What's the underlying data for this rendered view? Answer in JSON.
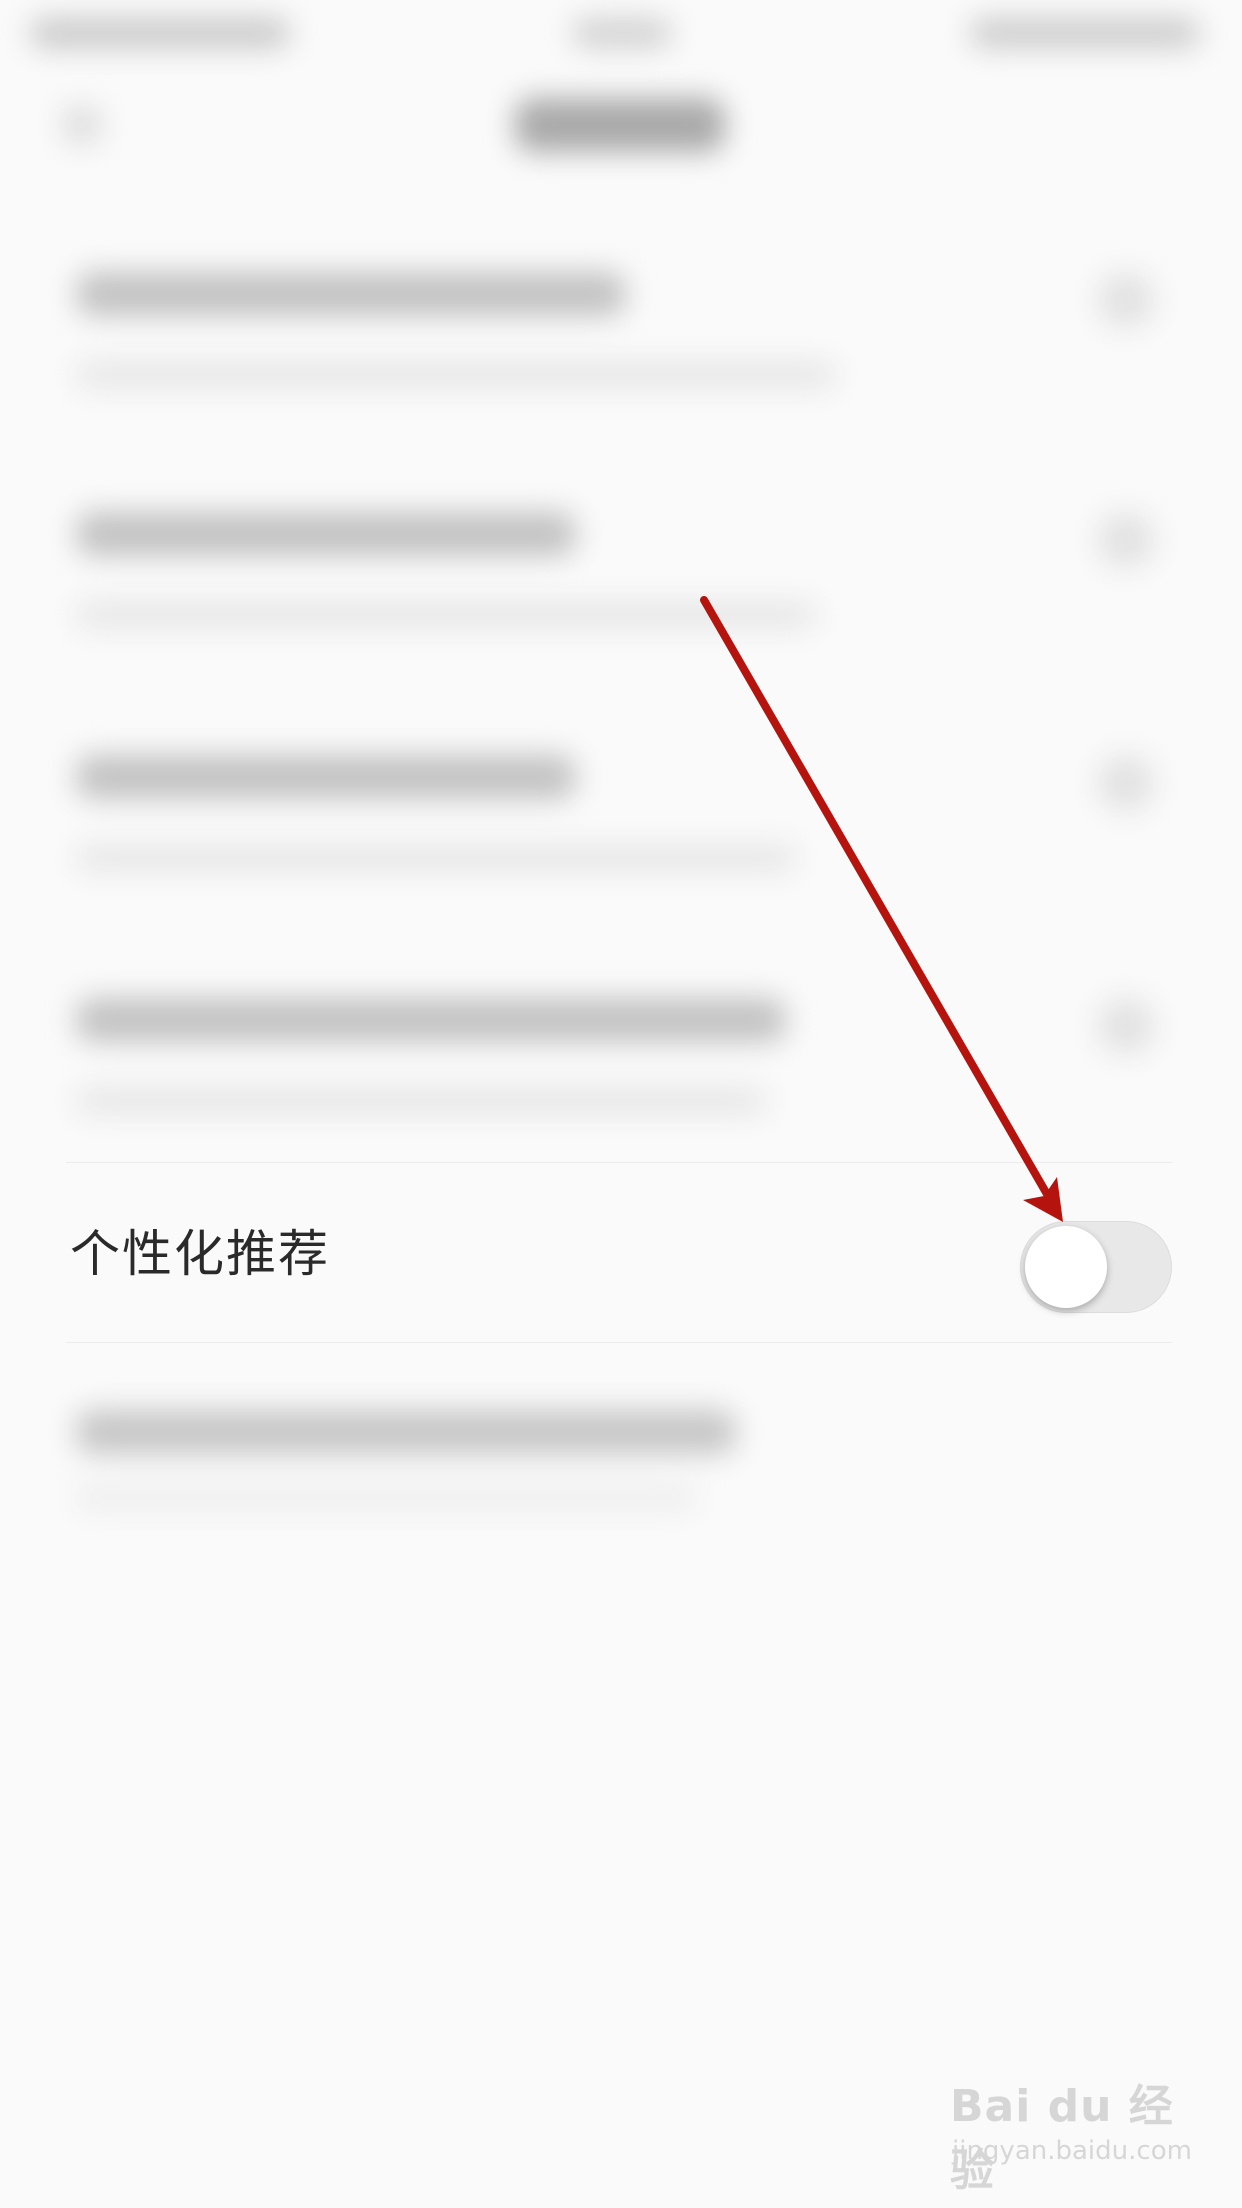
{
  "setting_row": {
    "label": "个性化推荐",
    "toggle_on": false
  },
  "colors": {
    "background": "#fafafa",
    "label_text": "#2a2a2a",
    "toggle_track_off": "#e8e8e8",
    "annotation_arrow": "#b5140e"
  },
  "watermark": {
    "brand": "Bai du 经验",
    "url": "jingyan.baidu.com"
  }
}
